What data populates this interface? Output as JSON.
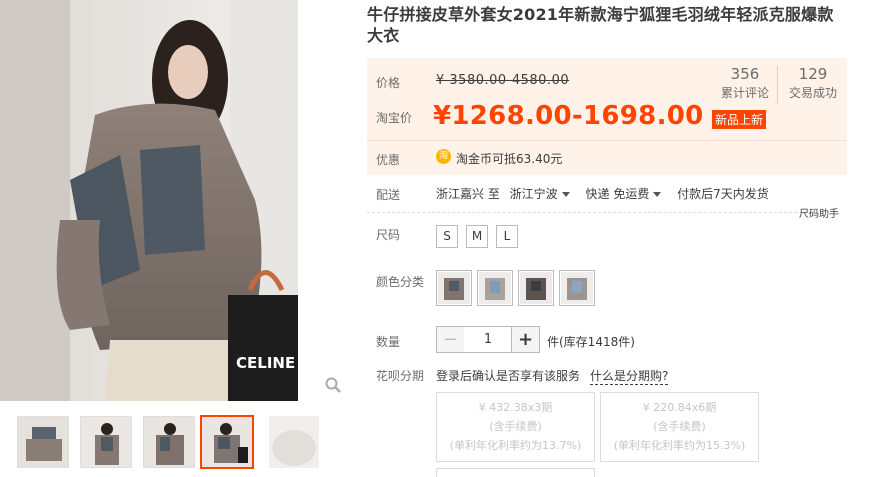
{
  "product": {
    "title": "牛仔拼接皮草外套女2021年新款海宁狐狸毛羽绒年轻派克服爆款大衣"
  },
  "price": {
    "label": "价格",
    "original": "¥ 3580.00-4580.00",
    "tb_label": "淘宝价",
    "current": "¥1268.00-1698.00",
    "badge": "新品上新"
  },
  "stats": {
    "reviews_count": "356",
    "reviews_label": "累计评论",
    "trades_count": "129",
    "trades_label": "交易成功"
  },
  "promo": {
    "label": "优惠",
    "coin_icon_text": "淘",
    "text": "淘金币可抵63.40元"
  },
  "shipping": {
    "label": "配送",
    "from": "浙江嘉兴 至",
    "to": "浙江宁波",
    "method": "快递 免运费",
    "dispatch": "付款后7天内发货"
  },
  "size": {
    "label": "尺码",
    "help": "尺码助手",
    "options": [
      "S",
      "M",
      "L"
    ]
  },
  "color": {
    "label": "颜色分类"
  },
  "quantity": {
    "label": "数量",
    "minus": "−",
    "value": "1",
    "plus": "+",
    "stock": "件(库存1418件)"
  },
  "huabei": {
    "label": "花呗分期",
    "note": "登录后确认是否享有该服务",
    "link": "什么是分期购?",
    "plans": [
      {
        "amount": "¥ 432.38x3期",
        "fee": "(含手续费)",
        "rate": "(单利年化利率约为13.7%)"
      },
      {
        "amount": "¥ 220.84x6期",
        "fee": "(含手续费)",
        "rate": "(单利年化利率约为15.3%)"
      }
    ]
  },
  "gallery": {
    "bag_text": "CELINE"
  },
  "colors": {
    "accent": "#ff4400",
    "price_bg": "#fff2e8",
    "coin": "#ffb500"
  }
}
